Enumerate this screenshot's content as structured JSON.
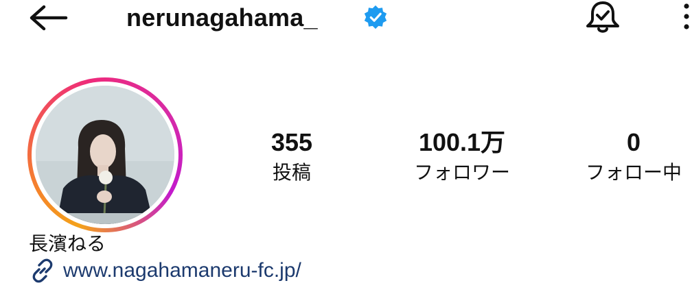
{
  "header": {
    "back_icon": "arrow-left-icon",
    "username": "nerunagahama_",
    "verified_icon": "verified-badge-icon",
    "verified_color": "#1e9bf0",
    "bell_icon": "bell-check-icon",
    "more_icon": "more-vertical-icon"
  },
  "profile": {
    "avatar_ring_colors": [
      "#f58529",
      "#ee2a7b",
      "#c21acc"
    ],
    "stats": [
      {
        "value": "355",
        "label": "投稿"
      },
      {
        "value": "100.1万",
        "label": "フォロワー"
      },
      {
        "value": "0",
        "label": "フォロー中"
      }
    ],
    "display_name": "長濱ねる",
    "link_icon": "link-icon",
    "website": "www.nagahamaneru-fc.jp/",
    "link_color": "#1c3a6e"
  }
}
